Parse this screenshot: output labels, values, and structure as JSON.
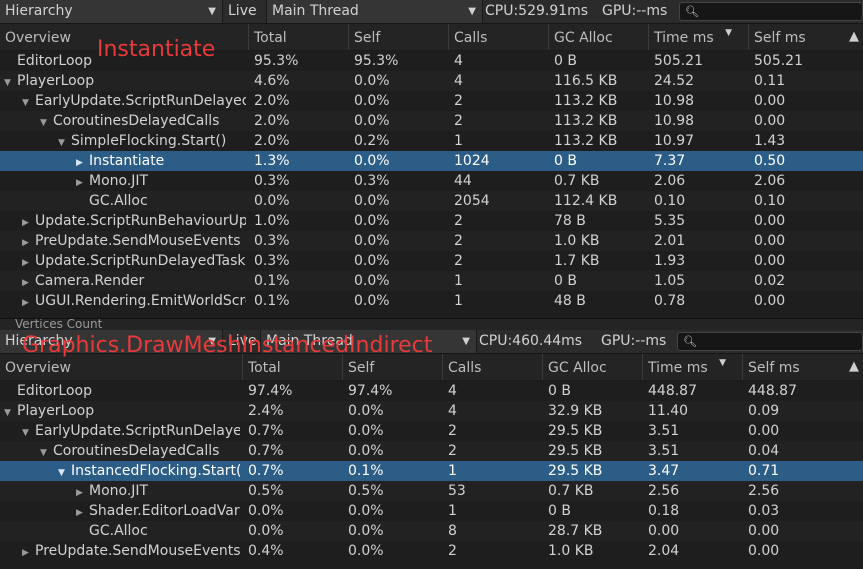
{
  "colors": {
    "selected_row": "#2c5d87",
    "annotation": "#e83a3a",
    "bg": "#1e1e1e"
  },
  "top": {
    "toolbar": {
      "view": "Hierarchy",
      "live": "Live",
      "thread": "Main Thread",
      "cpu": "CPU:529.91ms",
      "gpu": "GPU:--ms",
      "search_icon": "magnifier-icon"
    },
    "annotation": "Instantiate",
    "columns": [
      "Overview",
      "Total",
      "Self",
      "Calls",
      "GC Alloc",
      "Time ms",
      "Self ms"
    ],
    "rows": [
      {
        "name": "EditorLoop",
        "depth": 0,
        "expander": "none",
        "total": "95.3%",
        "self": "95.3%",
        "calls": "4",
        "gc": "0 B",
        "time": "505.21",
        "selfms": "505.21"
      },
      {
        "name": "PlayerLoop",
        "depth": 0,
        "expander": "open",
        "total": "4.6%",
        "self": "0.0%",
        "calls": "4",
        "gc": "116.5 KB",
        "time": "24.52",
        "selfms": "0.11"
      },
      {
        "name": "EarlyUpdate.ScriptRunDelayedDynamicFrameRate",
        "depth": 1,
        "expander": "open",
        "total": "2.0%",
        "self": "0.0%",
        "calls": "2",
        "gc": "113.2 KB",
        "time": "10.98",
        "selfms": "0.00"
      },
      {
        "name": "CoroutinesDelayedCalls",
        "depth": 2,
        "expander": "open",
        "total": "2.0%",
        "self": "0.0%",
        "calls": "2",
        "gc": "113.2 KB",
        "time": "10.98",
        "selfms": "0.00"
      },
      {
        "name": "SimpleFlocking.Start()",
        "depth": 3,
        "expander": "open",
        "total": "2.0%",
        "self": "0.2%",
        "calls": "1",
        "gc": "113.2 KB",
        "time": "10.97",
        "selfms": "1.43"
      },
      {
        "name": "Instantiate",
        "depth": 4,
        "expander": "closed",
        "selected": true,
        "total": "1.3%",
        "self": "0.0%",
        "calls": "1024",
        "gc": "0 B",
        "time": "7.37",
        "selfms": "0.50"
      },
      {
        "name": "Mono.JIT",
        "depth": 4,
        "expander": "closed",
        "total": "0.3%",
        "self": "0.3%",
        "calls": "44",
        "gc": "0.7 KB",
        "time": "2.06",
        "selfms": "2.06"
      },
      {
        "name": "GC.Alloc",
        "depth": 4,
        "expander": "none",
        "total": "0.0%",
        "self": "0.0%",
        "calls": "2054",
        "gc": "112.4 KB",
        "time": "0.10",
        "selfms": "0.10"
      },
      {
        "name": "Update.ScriptRunBehaviourUpdate",
        "depth": 1,
        "expander": "closed",
        "total": "1.0%",
        "self": "0.0%",
        "calls": "2",
        "gc": "78 B",
        "time": "5.35",
        "selfms": "0.00"
      },
      {
        "name": "PreUpdate.SendMouseEvents",
        "depth": 1,
        "expander": "closed",
        "total": "0.3%",
        "self": "0.0%",
        "calls": "2",
        "gc": "1.0 KB",
        "time": "2.01",
        "selfms": "0.00"
      },
      {
        "name": "Update.ScriptRunDelayedTasks",
        "depth": 1,
        "expander": "closed",
        "total": "0.3%",
        "self": "0.0%",
        "calls": "2",
        "gc": "1.7 KB",
        "time": "1.93",
        "selfms": "0.00"
      },
      {
        "name": "Camera.Render",
        "depth": 1,
        "expander": "closed",
        "total": "0.1%",
        "self": "0.0%",
        "calls": "1",
        "gc": "0 B",
        "time": "1.05",
        "selfms": "0.02"
      },
      {
        "name": "UGUI.Rendering.EmitWorldScreenspaceCameraGeometry",
        "depth": 1,
        "expander": "closed",
        "total": "0.1%",
        "self": "0.0%",
        "calls": "1",
        "gc": "48 B",
        "time": "0.78",
        "selfms": "0.00"
      }
    ],
    "partial_row": "Vertices Count"
  },
  "bottom": {
    "toolbar": {
      "view": "Hierarchy",
      "live": "Live",
      "thread": "Main Thread",
      "cpu": "CPU:460.44ms",
      "gpu": "GPU:--ms",
      "search_icon": "magnifier-icon"
    },
    "annotation": "Graphics.DrawMeshInstancedIndirect",
    "columns": [
      "Overview",
      "Total",
      "Self",
      "Calls",
      "GC Alloc",
      "Time ms",
      "Self ms"
    ],
    "rows": [
      {
        "name": "EditorLoop",
        "depth": 0,
        "expander": "none",
        "total": "97.4%",
        "self": "97.4%",
        "calls": "4",
        "gc": "0 B",
        "time": "448.87",
        "selfms": "448.87"
      },
      {
        "name": "PlayerLoop",
        "depth": 0,
        "expander": "open",
        "total": "2.4%",
        "self": "0.0%",
        "calls": "4",
        "gc": "32.9 KB",
        "time": "11.40",
        "selfms": "0.09"
      },
      {
        "name": "EarlyUpdate.ScriptRunDelayedDynamicFrameRate",
        "depth": 1,
        "expander": "open",
        "total": "0.7%",
        "self": "0.0%",
        "calls": "2",
        "gc": "29.5 KB",
        "time": "3.51",
        "selfms": "0.00"
      },
      {
        "name": "CoroutinesDelayedCalls",
        "depth": 2,
        "expander": "open",
        "total": "0.7%",
        "self": "0.0%",
        "calls": "2",
        "gc": "29.5 KB",
        "time": "3.51",
        "selfms": "0.04"
      },
      {
        "name": "InstancedFlocking.Start()",
        "depth": 3,
        "expander": "open",
        "selected": true,
        "total": "0.7%",
        "self": "0.1%",
        "calls": "1",
        "gc": "29.5 KB",
        "time": "3.47",
        "selfms": "0.71"
      },
      {
        "name": "Mono.JIT",
        "depth": 4,
        "expander": "closed",
        "total": "0.5%",
        "self": "0.5%",
        "calls": "53",
        "gc": "0.7 KB",
        "time": "2.56",
        "selfms": "2.56"
      },
      {
        "name": "Shader.EditorLoadVariant",
        "depth": 4,
        "expander": "closed",
        "total": "0.0%",
        "self": "0.0%",
        "calls": "1",
        "gc": "0 B",
        "time": "0.18",
        "selfms": "0.03"
      },
      {
        "name": "GC.Alloc",
        "depth": 4,
        "expander": "none",
        "total": "0.0%",
        "self": "0.0%",
        "calls": "8",
        "gc": "28.7 KB",
        "time": "0.00",
        "selfms": "0.00"
      },
      {
        "name": "PreUpdate.SendMouseEvents",
        "depth": 1,
        "expander": "closed",
        "total": "0.4%",
        "self": "0.0%",
        "calls": "2",
        "gc": "1.0 KB",
        "time": "2.04",
        "selfms": "0.00"
      }
    ]
  }
}
